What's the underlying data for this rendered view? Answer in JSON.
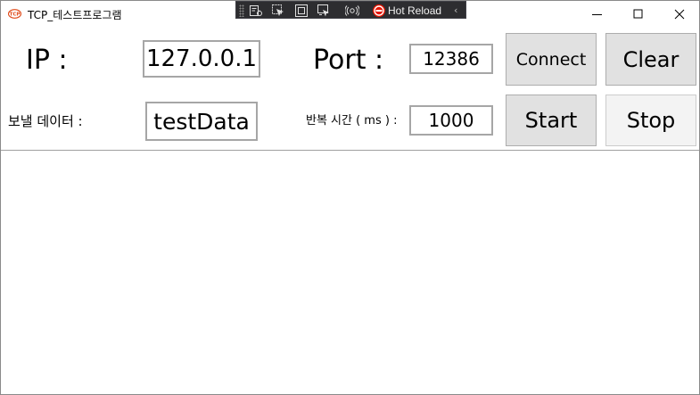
{
  "window": {
    "title": "TCP_테스트프로그램",
    "controls": {
      "minimize": "minimize-icon",
      "maximize": "maximize-icon",
      "close": "close-icon"
    }
  },
  "debug_toolbar": {
    "hot_reload_label": "Hot Reload",
    "collapse_glyph": "‹",
    "icons": [
      "live-visual-tree-icon",
      "select-element-icon",
      "display-layout-adorners-icon",
      "track-focus-icon",
      "hot-reload-status-icon",
      "hot-reload-stop-icon"
    ]
  },
  "form": {
    "ip_label": "IP :",
    "ip_value": "127.0.0.1",
    "port_label": "Port :",
    "port_value": "12386",
    "send_data_label": "보낼 데이터 :",
    "send_data_value": "testData",
    "interval_label": "반복 시간 ( ms ) :",
    "interval_value": "1000"
  },
  "buttons": {
    "connect": "Connect",
    "clear": "Clear",
    "start": "Start",
    "stop": "Stop"
  },
  "log": {
    "content": ""
  }
}
